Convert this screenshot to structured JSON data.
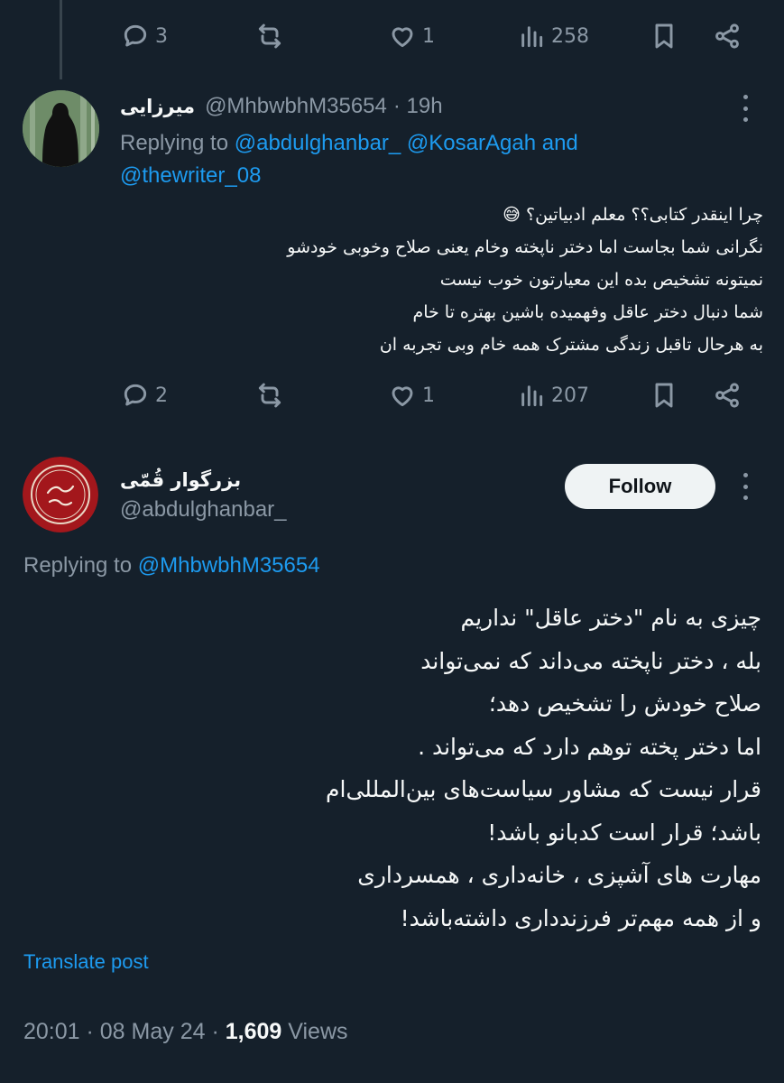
{
  "top_actions": {
    "replies": "3",
    "likes": "1",
    "views": "258"
  },
  "reply1": {
    "display_name": "میرزایی",
    "handle": "@MhbwbhM35654",
    "time": "· 19h",
    "replying_prefix": "Replying to",
    "replying_mentions_line1": "@abdulghanbar_ @KosarAgah",
    "replying_and": "and",
    "replying_mentions_line2": "@thewriter_08",
    "body_lines": [
      "چرا اینقدر کتابی؟؟ معلم ادبیاتین؟ 😅",
      "نگرانی شما بجاست اما دختر ناپخته وخام یعنی صلاح وخوبی خودشو",
      "نمیتونه تشخیص بده این معیارتون خوب نیست",
      "شما دنبال دختر عاقل وفهمیده باشین بهتره تا خام",
      "به هرحال تاقبل زندگی مشترک همه خام وبی تجربه ان"
    ],
    "actions": {
      "replies": "2",
      "likes": "1",
      "views": "207"
    }
  },
  "main": {
    "display_name": "بزرگوار قُمّی",
    "handle": "@abdulghanbar_",
    "follow_label": "Follow",
    "replying_prefix": "Replying to",
    "replying_mention": "@MhbwbhM35654",
    "body_lines": [
      "چیزی به نام \"دختر عاقل\" نداریم",
      "بله ، دختر ناپخته می‌داند که نمی‌تواند",
      "صلاح خودش را تشخیص دهد؛",
      "اما دختر پخته توهم دارد که می‌تواند .",
      "قرار نیست که مشاور سیاست‌های بین‌المللی‌ام",
      "باشد؛ قرار است کدبانو باشد!",
      "مهارت های آشپزی ، خانه‌داری ، همسرداری",
      "و از همه مهم‌تر فرزندداری داشته‌باشد!"
    ],
    "translate_label": "Translate post",
    "timestamp": "20:01 · 08 May 24 ·",
    "views_count": "1,609",
    "views_label": "Views"
  },
  "colors": {
    "background": "#15202b",
    "link": "#1d9bf0",
    "muted": "#8b98a5",
    "text": "#f7f9f9"
  }
}
